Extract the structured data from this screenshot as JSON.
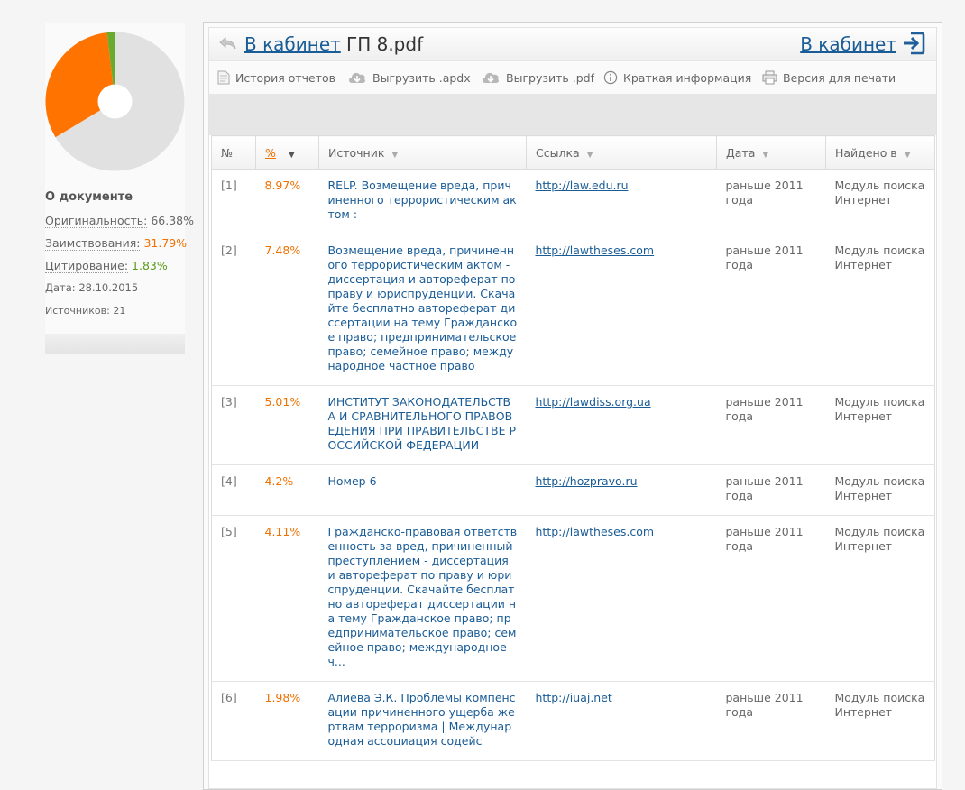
{
  "sidebar": {
    "title": "О документе",
    "originality_label": "Оригинальность:",
    "originality_value": "66.38%",
    "borrowing_label": "Заимствования:",
    "borrowing_value": "31.79%",
    "citation_label": "Цитирование:",
    "citation_value": "1.83%",
    "date_label": "Дата:",
    "date_value": "28.10.2015",
    "sources_label": "Источников:",
    "sources_value": "21"
  },
  "chart_data": {
    "type": "pie",
    "categories": [
      "Оригинальность",
      "Заимствования",
      "Цитирование"
    ],
    "values": [
      66.38,
      31.79,
      1.83
    ],
    "colors": [
      "#e1e1e1",
      "#ff7300",
      "#6aab2e"
    ],
    "donut": true
  },
  "header": {
    "back_link": "В кабинет",
    "file_name": "ГП 8.pdf",
    "right_link": "В кабинет"
  },
  "toolbar": {
    "history": "История отчетов",
    "apdx": "Выгрузить .apdx",
    "pdf": "Выгрузить .pdf",
    "info": "Краткая информация",
    "print": "Версия для печати"
  },
  "table": {
    "headers": {
      "num": "№",
      "pct": "%",
      "source": "Источник",
      "link": "Ссылка",
      "date": "Дата",
      "found": "Найдено в"
    },
    "rows": [
      {
        "num": "[1]",
        "pct": "8.97%",
        "source": "RELP. Возмещение вреда, причиненного террористическим актом :",
        "link": "http://law.edu.ru",
        "date": "раньше 2011 года",
        "found": "Модуль поиска Интернет"
      },
      {
        "num": "[2]",
        "pct": "7.48%",
        "source": "Возмещение вреда, причиненного террористическим актом - диссертация и автореферат по праву и юриспруденции. Скачайте бесплатно автореферат диссертации на тему Гражданское право; предпринимательское право; семейное право; международное частное право",
        "link": "http://lawtheses.com",
        "date": "раньше 2011 года",
        "found": "Модуль поиска Интернет"
      },
      {
        "num": "[3]",
        "pct": "5.01%",
        "source": "ИНСТИТУТ ЗАКОНОДАТЕЛЬСТВА И СРАВНИТЕЛЬНОГО ПРАВОВЕДЕНИЯ ПРИ ПРАВИТЕЛЬСТВЕ РОССИЙСКОЙ ФЕДЕРАЦИИ",
        "link": "http://lawdiss.org.ua",
        "date": "раньше 2011 года",
        "found": "Модуль поиска Интернет"
      },
      {
        "num": "[4]",
        "pct": "4.2%",
        "source": "Номер 6",
        "link": "http://hozpravo.ru",
        "date": "раньше 2011 года",
        "found": "Модуль поиска Интернет"
      },
      {
        "num": "[5]",
        "pct": "4.11%",
        "source": "Гражданско-правовая ответственность за вред, причиненный преступлением - диссертация и автореферат по праву и юриспруденции. Скачайте бесплатно автореферат диссертации на тему Гражданское право; предпринимательское право; семейное право; международное ч...",
        "link": "http://lawtheses.com",
        "date": "раньше 2011 года",
        "found": "Модуль поиска Интернет"
      },
      {
        "num": "[6]",
        "pct": "1.98%",
        "source": "Алиева Э.К. Проблемы компенсации причиненного ущерба жертвам терроризма | Международная ассоциация содейс",
        "link": "http://iuaj.net",
        "date": "раньше 2011 года",
        "found": "Модуль поиска Интернет"
      }
    ]
  }
}
